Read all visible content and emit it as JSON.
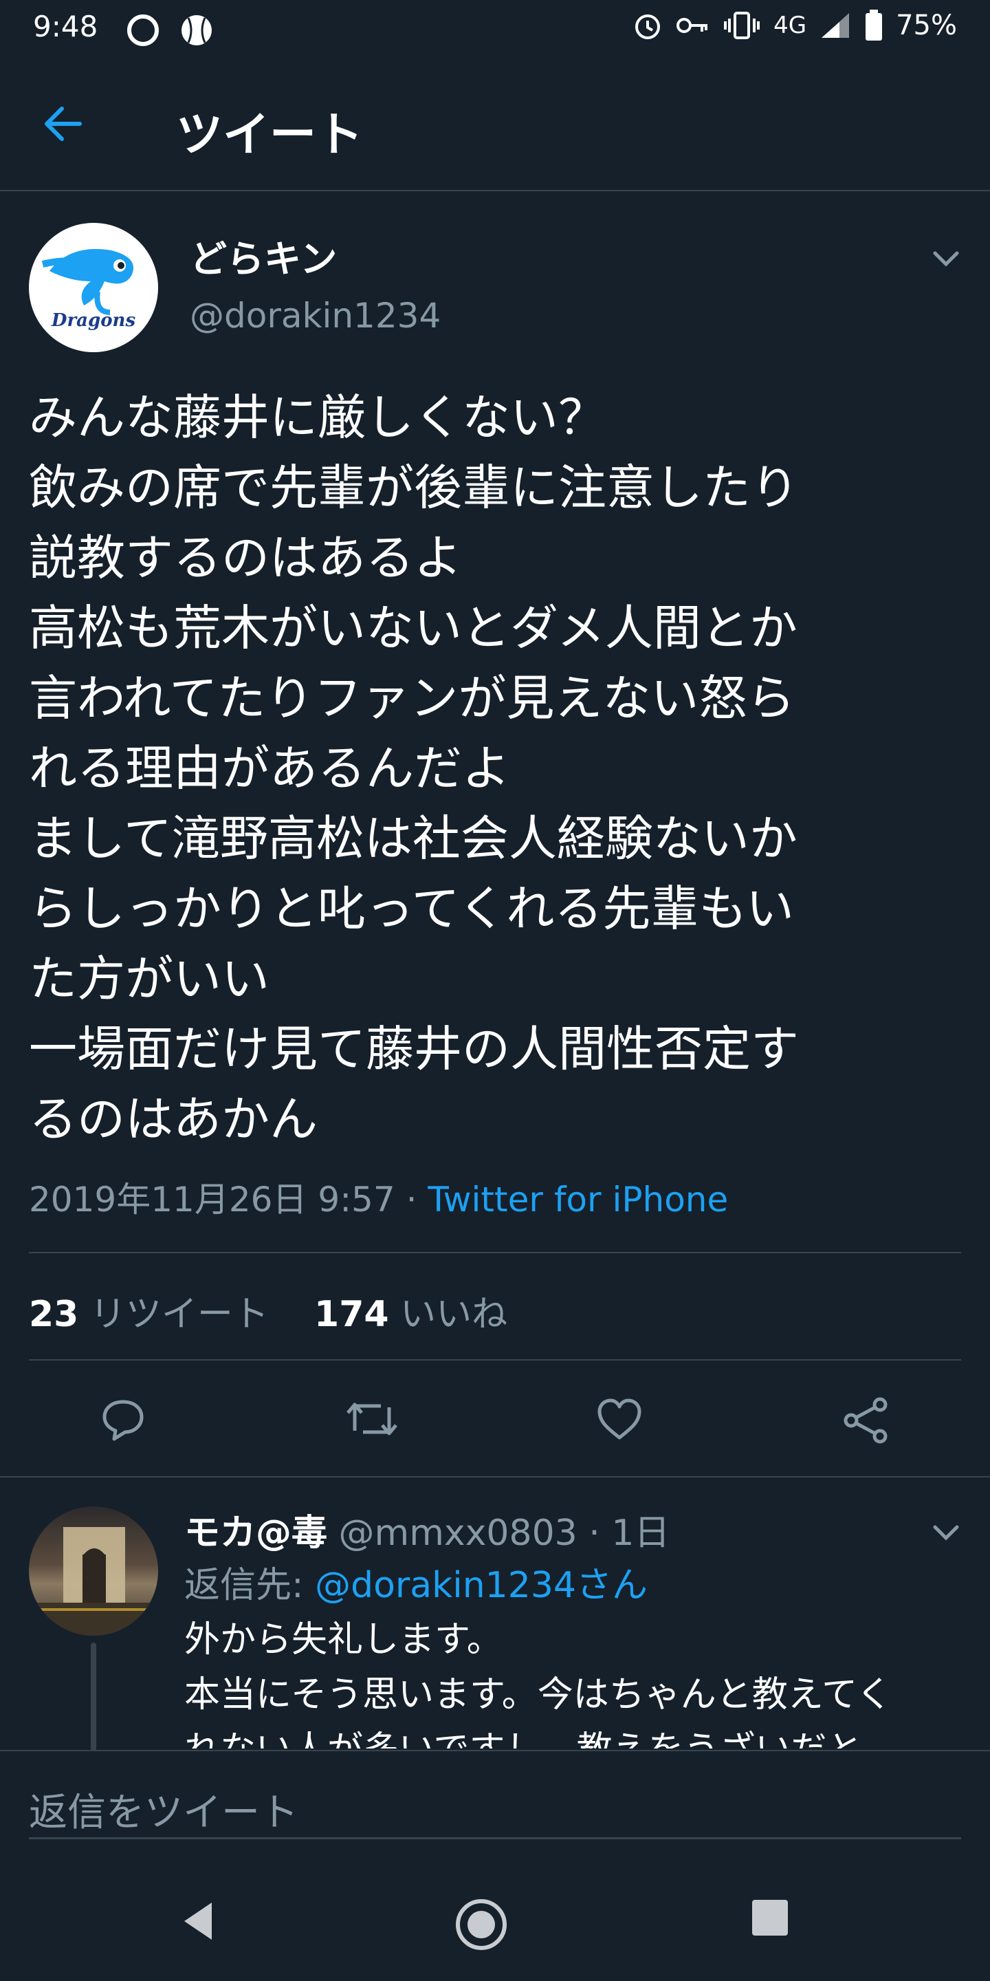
{
  "status": {
    "time": "9:48",
    "network": "4G",
    "battery": "75%"
  },
  "header": {
    "title": "ツイート"
  },
  "tweet": {
    "author_name": "どらキン",
    "author_handle": "@dorakin1234",
    "avatar_text": "Dragons",
    "text": "みんな藤井に厳しくない？\n飲みの席で先輩が後輩に注意したり\n説教するのはあるよ\n高松も荒木がいないとダメ人間とか\n言われてたりファンが見えない怒ら\nれる理由があるんだよ\nまして滝野高松は社会人経験ないか\nらしっかりと叱ってくれる先輩もい\nた方がいい\n一場面だけ見て藤井の人間性否定す\nるのはあかん",
    "date": "2019年11月26日 9:57",
    "separator": " · ",
    "source": "Twitter for iPhone",
    "retweets_count": "23",
    "retweets_label": "リツイート",
    "likes_count": "174",
    "likes_label": "いいね"
  },
  "reply": {
    "name": "モカ@毒",
    "meta": "@mmxx0803 · 1日",
    "reply_prefix": "返信先: ",
    "reply_mention": "@dorakin1234さん",
    "text": "外から失礼します。\n本当にそう思います。今はちゃんと教えてく\nれない人が多いですし、教えをうざいだと"
  },
  "composer": {
    "placeholder": "返信をツイート"
  },
  "colors": {
    "background": "#15202b",
    "accent": "#1da1f2",
    "secondary_text": "#8899a6",
    "divider": "#38444d"
  }
}
